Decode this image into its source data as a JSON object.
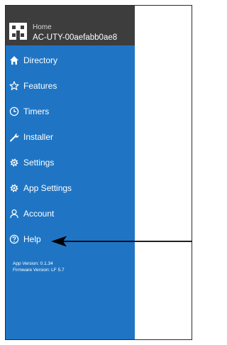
{
  "header": {
    "home_label": "Home",
    "device_name": "AC-UTY-00aefabb0ae8"
  },
  "menu": {
    "items": [
      {
        "label": "Directory",
        "icon": "home-icon"
      },
      {
        "label": "Features",
        "icon": "star-icon"
      },
      {
        "label": "Timers",
        "icon": "clock-icon"
      },
      {
        "label": "Installer",
        "icon": "wrench-icon"
      },
      {
        "label": "Settings",
        "icon": "gear-icon"
      },
      {
        "label": "App Settings",
        "icon": "gear-icon"
      },
      {
        "label": "Account",
        "icon": "user-icon"
      },
      {
        "label": "Help",
        "icon": "help-icon"
      }
    ]
  },
  "version": {
    "app": "App Version: 0.1.34",
    "firmware": "Firmware Version: LF 5.7"
  },
  "colors": {
    "sidebar": "#1f75c4",
    "header": "#3d3d3d",
    "text": "#ffffff"
  }
}
